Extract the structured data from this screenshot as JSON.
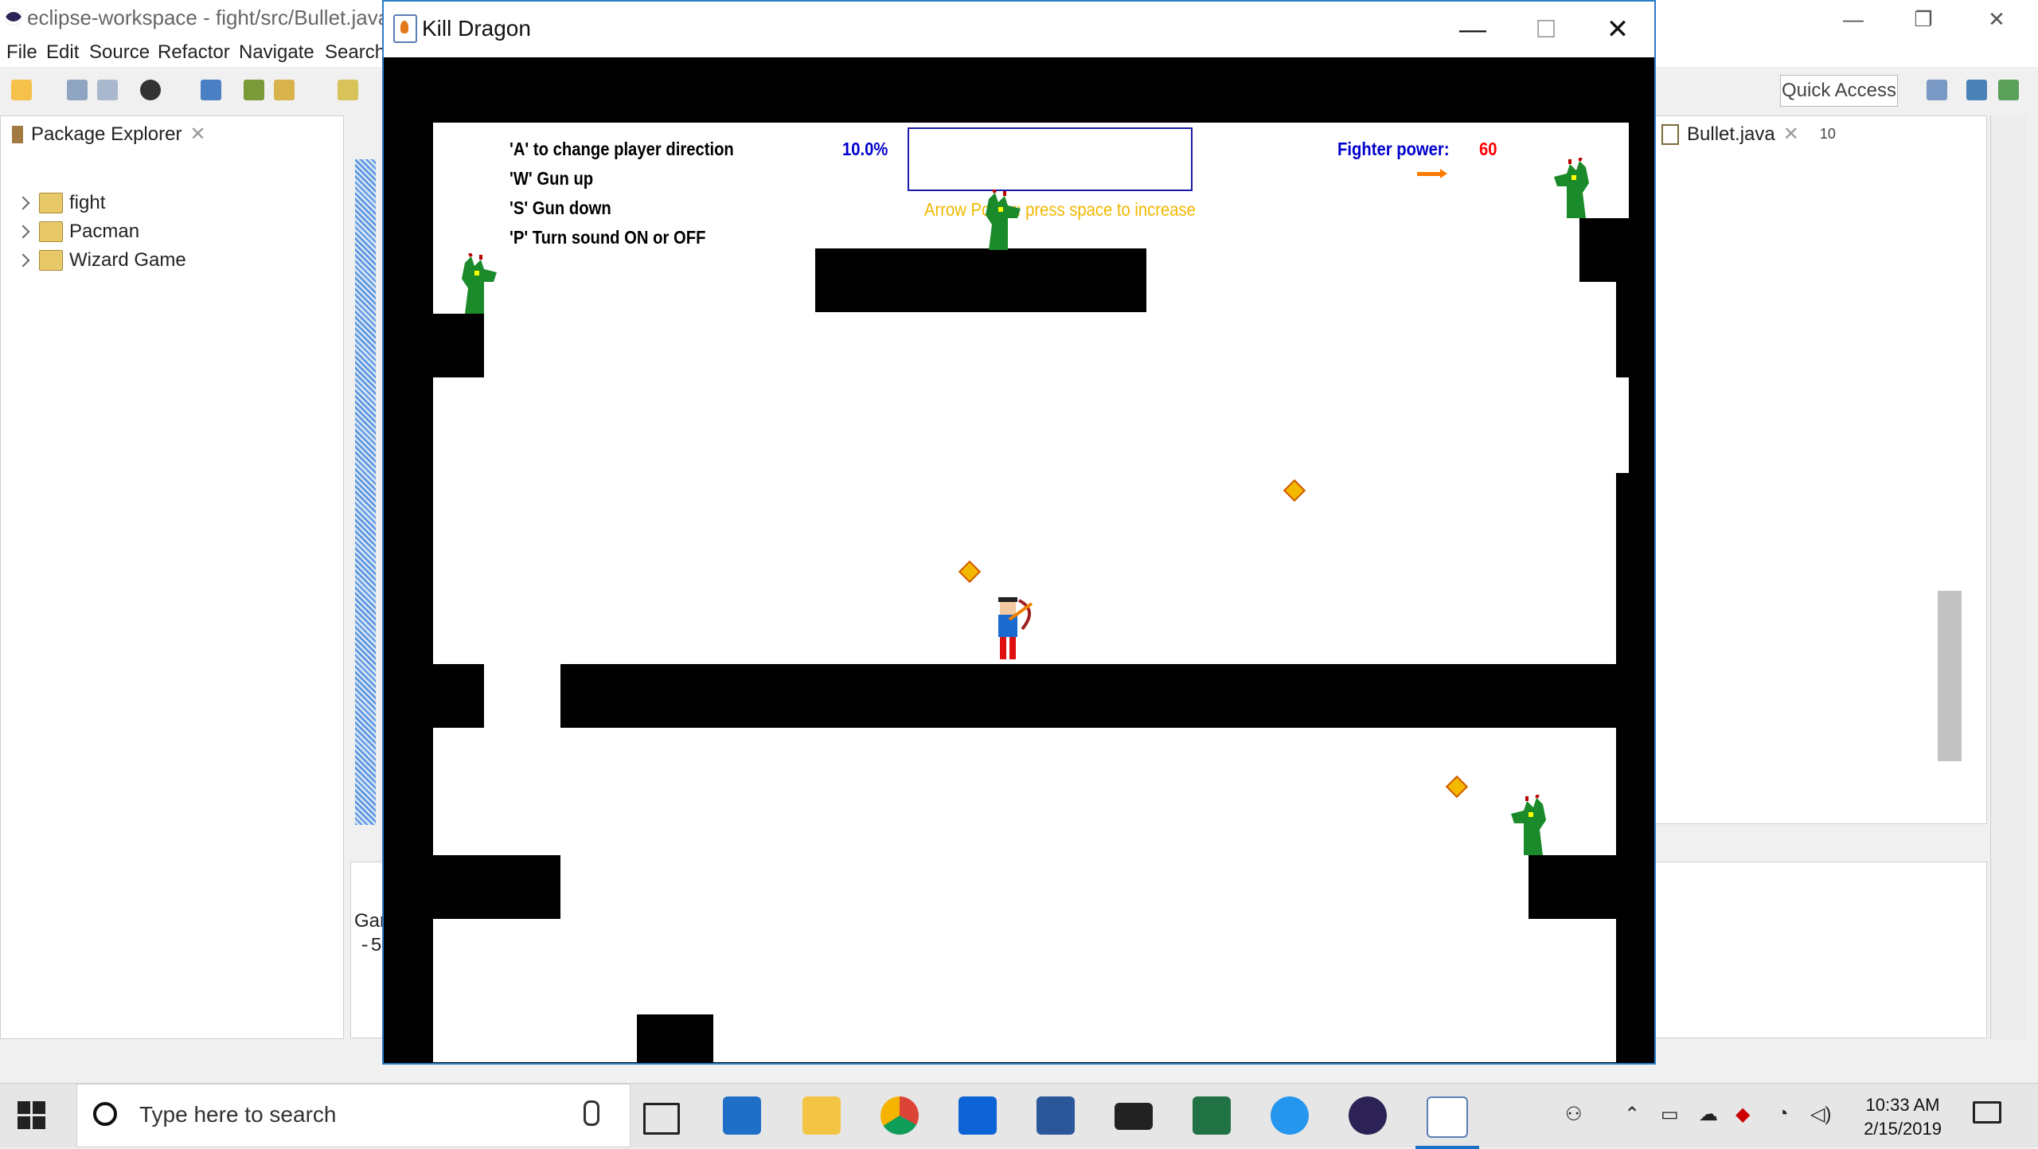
{
  "eclipse": {
    "title": "eclipse-workspace - fight/src/Bullet.java -",
    "menu": [
      "File",
      "Edit",
      "Source",
      "Refactor",
      "Navigate",
      "Search"
    ],
    "quick_access": "Quick Access",
    "package_explorer": {
      "tab_label": "Package Explorer",
      "projects": [
        "fight",
        "Pacman",
        "Wizard Game"
      ]
    },
    "editor_tab": "Bullet.java",
    "overflow_count": "10",
    "bottom_panel_text": [
      "Gar",
      "-5"
    ]
  },
  "game_window": {
    "title": "Kill Dragon",
    "help": [
      "'A' to change player direction",
      "'W' Gun up",
      "'S' Gun down",
      "'P' Turn sound ON or OFF"
    ],
    "arrow_power_percent": "10.0%",
    "arrow_power_hint": "Arrow Power: press space to increase",
    "fighter_power_label": "Fighter power:",
    "fighter_power_value": "60",
    "colors": {
      "help_text": "#000000",
      "percent": "#0000cc",
      "hint": "#f2b800",
      "fighter_value": "#ff0000",
      "dragon": "#1a8a2a"
    }
  },
  "taskbar": {
    "search_placeholder": "Type here to search",
    "apps": [
      "task-view",
      "outlook",
      "file-explorer",
      "chrome",
      "dropbox",
      "word",
      "mail",
      "excel",
      "docker",
      "eclipse",
      "java"
    ],
    "time": "10:33 AM",
    "date": "2/15/2019"
  }
}
